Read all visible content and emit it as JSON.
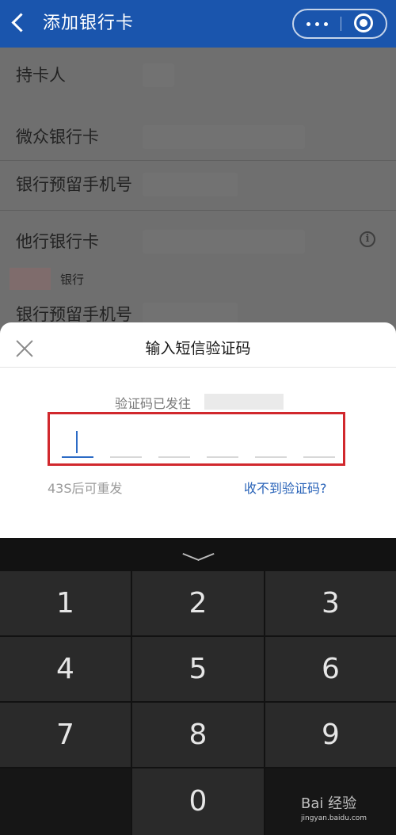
{
  "navbar": {
    "title": "添加银行卡"
  },
  "form": {
    "cardholder_label": "持卡人",
    "webank_card_label": "微众银行卡",
    "reserved_phone_label": "银行预留手机号",
    "other_bank_card_label": "他行银行卡",
    "bank_name": "银行",
    "reserved_phone_label_2": "银行预留手机号"
  },
  "sms_sheet": {
    "title": "输入短信验证码",
    "sent_to_text": "验证码已发往",
    "code_length": 6,
    "resend_text": "43S后可重发",
    "no_code_link": "收不到验证码?"
  },
  "keypad": {
    "keys": [
      "1",
      "2",
      "3",
      "4",
      "5",
      "6",
      "7",
      "8",
      "9",
      "0"
    ]
  },
  "watermark": {
    "text": "Bai 经验",
    "url": "jingyan.baidu.com"
  },
  "colors": {
    "nav_blue": "#1a55ad",
    "highlight_red": "#d1282d",
    "link_blue": "#2963b8",
    "keypad_bg": "#121212"
  }
}
